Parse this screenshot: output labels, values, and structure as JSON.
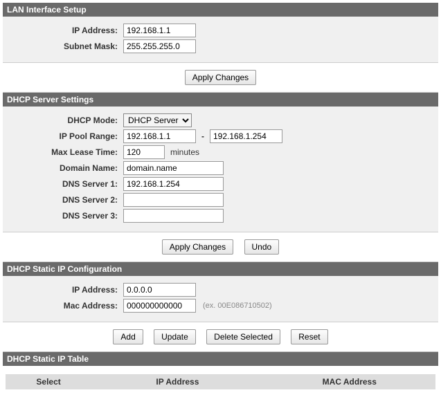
{
  "lan": {
    "title": "LAN Interface Setup",
    "ip_label": "IP Address:",
    "ip_value": "192.168.1.1",
    "mask_label": "Subnet Mask:",
    "mask_value": "255.255.255.0",
    "apply": "Apply Changes"
  },
  "dhcp": {
    "title": "DHCP Server Settings",
    "mode_label": "DHCP Mode:",
    "mode_value": "DHCP Server",
    "pool_label": "IP Pool Range:",
    "pool_start": "192.168.1.1",
    "pool_end": "192.168.1.254",
    "lease_label": "Max Lease Time:",
    "lease_value": "120",
    "lease_unit": "minutes",
    "domain_label": "Domain Name:",
    "domain_value": "domain.name",
    "dns1_label": "DNS Server 1:",
    "dns1_value": "192.168.1.254",
    "dns2_label": "DNS Server 2:",
    "dns2_value": "",
    "dns3_label": "DNS Server 3:",
    "dns3_value": "",
    "apply": "Apply Changes",
    "undo": "Undo"
  },
  "static_cfg": {
    "title": "DHCP Static IP Configuration",
    "ip_label": "IP Address:",
    "ip_value": "0.0.0.0",
    "mac_label": "Mac Address:",
    "mac_value": "000000000000",
    "mac_hint": "(ex. 00E086710502)",
    "add": "Add",
    "update": "Update",
    "delete": "Delete Selected",
    "reset": "Reset"
  },
  "static_table": {
    "title": "DHCP Static IP Table",
    "col_select": "Select",
    "col_ip": "IP Address",
    "col_mac": "MAC Address"
  }
}
